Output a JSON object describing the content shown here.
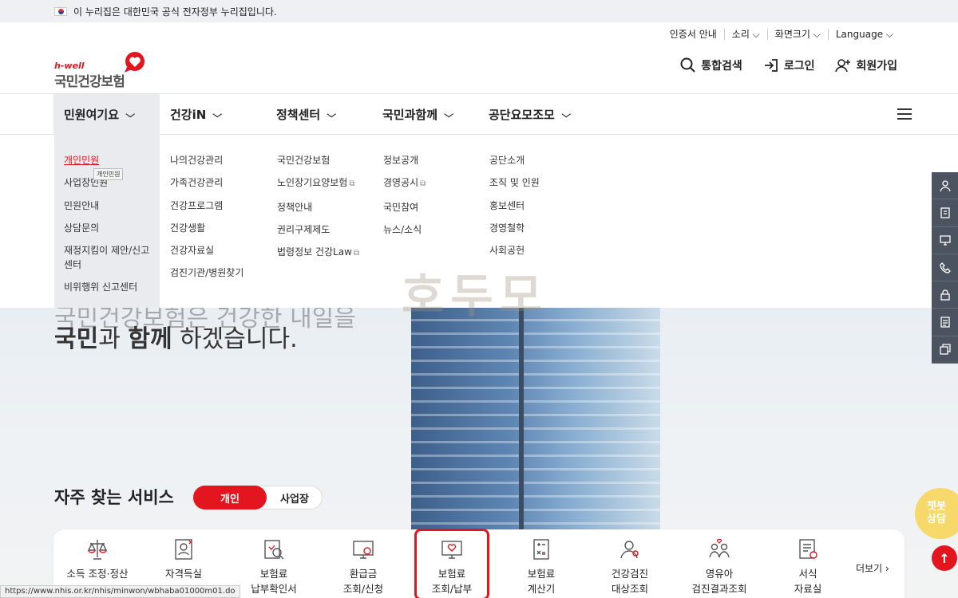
{
  "gov_banner": {
    "text": "이 누리집은 대한민국 공식 전자정부 누리집입니다."
  },
  "utility": [
    "인증서 안내",
    "소리 ⌵",
    "화면크기 ⌵",
    "Language ⌵"
  ],
  "logo": {
    "sub": "h-well",
    "main": "국민건강보험"
  },
  "top_actions": {
    "search": "통합검색",
    "login": "로그인",
    "join": "회원가입"
  },
  "gnb": [
    {
      "label": "민원여기요"
    },
    {
      "label": "건강iN"
    },
    {
      "label": "정책센터"
    },
    {
      "label": "국민과함께"
    },
    {
      "label": "공단요모조모"
    }
  ],
  "mega": {
    "col1": [
      "개인민원",
      "사업장민원",
      "민원안내",
      "상담문의",
      "재정지킴이 제안/신고",
      "센터",
      "비위행위 신고센터"
    ],
    "col2": [
      "나의건강관리",
      "가족건강관리",
      "건강프로그램",
      "건강생활",
      "건강자료실",
      "검진기관/병원찾기"
    ],
    "col3": [
      "국민건강보험",
      "노인장기요양보험",
      "정책안내",
      "권리구제제도",
      "법령정보 건강Law"
    ],
    "col4": [
      "정보공개",
      "경영공시",
      "국민참여",
      "뉴스/소식"
    ],
    "col5": [
      "공단소개",
      "조직 및 인원",
      "홍보센터",
      "경영철학",
      "사회공헌"
    ]
  },
  "tooltip": "개인민원",
  "watermark": "호두모",
  "hero": {
    "line1": "국민건강보험은 건강한 내일을",
    "strong1": "국민",
    "mid1": "과 ",
    "strong2": "함께",
    "mid2": " 하겠습니다."
  },
  "services": {
    "title": "자주 찾는 서비스",
    "toggle_on": "개인",
    "toggle_off": "사업장",
    "items": [
      {
        "l1": "소득 조정·정산",
        "l2": ""
      },
      {
        "l1": "자격득실",
        "l2": ""
      },
      {
        "l1": "보험료",
        "l2": "납부확인서"
      },
      {
        "l1": "환급금",
        "l2": "조회/신청"
      },
      {
        "l1": "보험료",
        "l2": "조회/납부"
      },
      {
        "l1": "보험료",
        "l2": "계산기"
      },
      {
        "l1": "건강검진",
        "l2": "대상조회"
      },
      {
        "l1": "영유아",
        "l2": "검진결과조회"
      },
      {
        "l1": "서식",
        "l2": "자료실"
      }
    ],
    "more": "더보기"
  },
  "chatbot": {
    "l1": "챗봇",
    "l2": "상담"
  },
  "status_url": "https://www.nhis.or.kr/nhis/minwon/wbhaba01000m01.do",
  "colors": {
    "brand": "#e3161f",
    "quick_bar": "#4b5260"
  }
}
